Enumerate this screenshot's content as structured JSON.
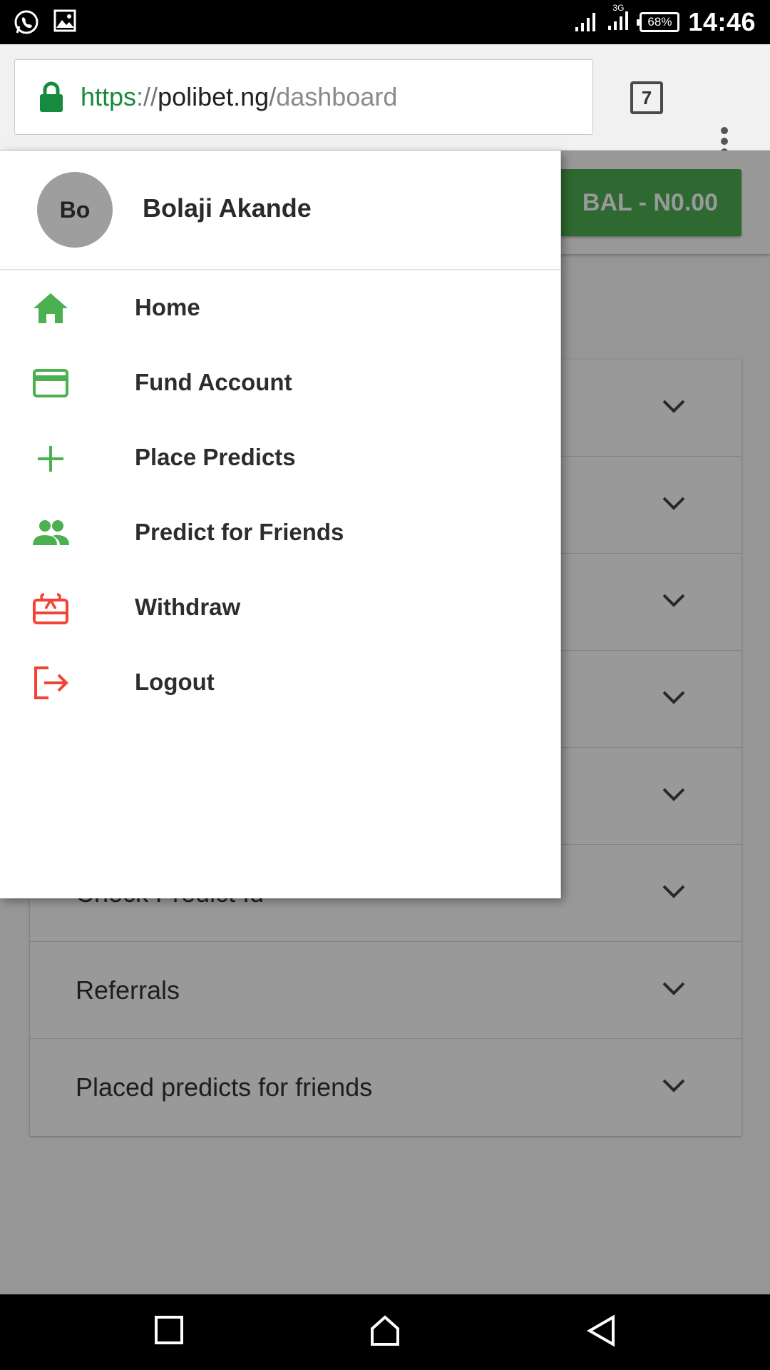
{
  "status_bar": {
    "time": "14:46",
    "battery": "68%",
    "network": "3G",
    "left_icons": [
      "whatsapp-icon",
      "image-icon"
    ]
  },
  "browser": {
    "url_scheme": "https",
    "url_separator": "://",
    "url_host": "polibet.ng",
    "url_slash": "/",
    "url_path": "dashboard",
    "tab_count": "7"
  },
  "page": {
    "balance_label": "BAL - N0.00",
    "accordion": [
      {
        "label": ""
      },
      {
        "label": ""
      },
      {
        "label": ""
      },
      {
        "label": ""
      },
      {
        "label": ""
      },
      {
        "label": "Check Predict Id"
      },
      {
        "label": "Referrals"
      },
      {
        "label": "Placed predicts for friends"
      }
    ]
  },
  "drawer": {
    "avatar_initials": "Bo",
    "user_name": "Bolaji Akande",
    "items": [
      {
        "label": "Home",
        "icon": "home-icon",
        "color": "#4caf50"
      },
      {
        "label": "Fund Account",
        "icon": "credit-card-icon",
        "color": "#4caf50"
      },
      {
        "label": "Place Predicts",
        "icon": "plus-icon",
        "color": "#4caf50"
      },
      {
        "label": "Predict for Friends",
        "icon": "people-icon",
        "color": "#4caf50"
      },
      {
        "label": "Withdraw",
        "icon": "gift-card-icon",
        "color": "#f44336"
      },
      {
        "label": "Logout",
        "icon": "logout-icon",
        "color": "#f44336"
      }
    ]
  },
  "colors": {
    "accent_green": "#4caf50",
    "danger_red": "#f44336",
    "secure_green": "#168a3e"
  }
}
